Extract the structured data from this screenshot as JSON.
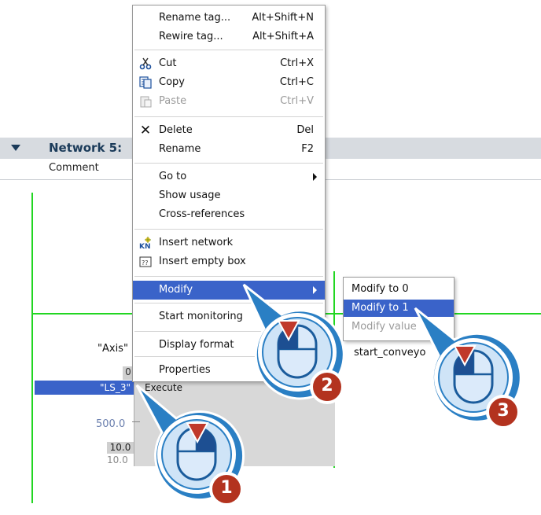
{
  "network": {
    "title": "Network 5:",
    "comment": "Comment"
  },
  "ladder": {
    "axis_label": "\"Axis\"",
    "c_cell": "0",
    "ls3": "\"LS_3\"",
    "execute_pin": "Execute",
    "value_500": "500.0",
    "value_10_box": "10.0",
    "value_10": "10.0",
    "start_conveyor": "start_conveyo"
  },
  "context_menu": {
    "items": [
      {
        "label": "Rename tag...",
        "shortcut": "Alt+Shift+N"
      },
      {
        "label": "Rewire tag...",
        "shortcut": "Alt+Shift+A"
      },
      {
        "label": "Cut",
        "shortcut": "Ctrl+X",
        "icon": "scissors-icon"
      },
      {
        "label": "Copy",
        "shortcut": "Ctrl+C",
        "icon": "copy-icon"
      },
      {
        "label": "Paste",
        "shortcut": "Ctrl+V",
        "icon": "paste-icon",
        "disabled": true
      },
      {
        "label": "Delete",
        "shortcut": "Del",
        "icon": "delete-x-icon"
      },
      {
        "label": "Rename",
        "shortcut": "F2"
      },
      {
        "label": "Go to"
      },
      {
        "label": "Show usage"
      },
      {
        "label": "Cross-references"
      },
      {
        "label": "Insert network",
        "icon": "insert-network-icon"
      },
      {
        "label": "Insert empty box",
        "icon": "empty-box-icon"
      },
      {
        "label": "Modify",
        "highlighted": true
      },
      {
        "label": "Start monitoring"
      },
      {
        "label": "Display format"
      },
      {
        "label": "Properties"
      }
    ]
  },
  "submenu": {
    "items": [
      {
        "label": "Modify to 0"
      },
      {
        "label": "Modify to 1",
        "highlighted": true
      },
      {
        "label": "Modify value",
        "disabled": true
      }
    ]
  },
  "callouts": [
    {
      "number": "1"
    },
    {
      "number": "2"
    },
    {
      "number": "3"
    }
  ],
  "colors": {
    "highlight": "#3a63c9",
    "wire": "#22d622",
    "callout_ring": "#2a7fc4",
    "badge": "#c0392b"
  }
}
